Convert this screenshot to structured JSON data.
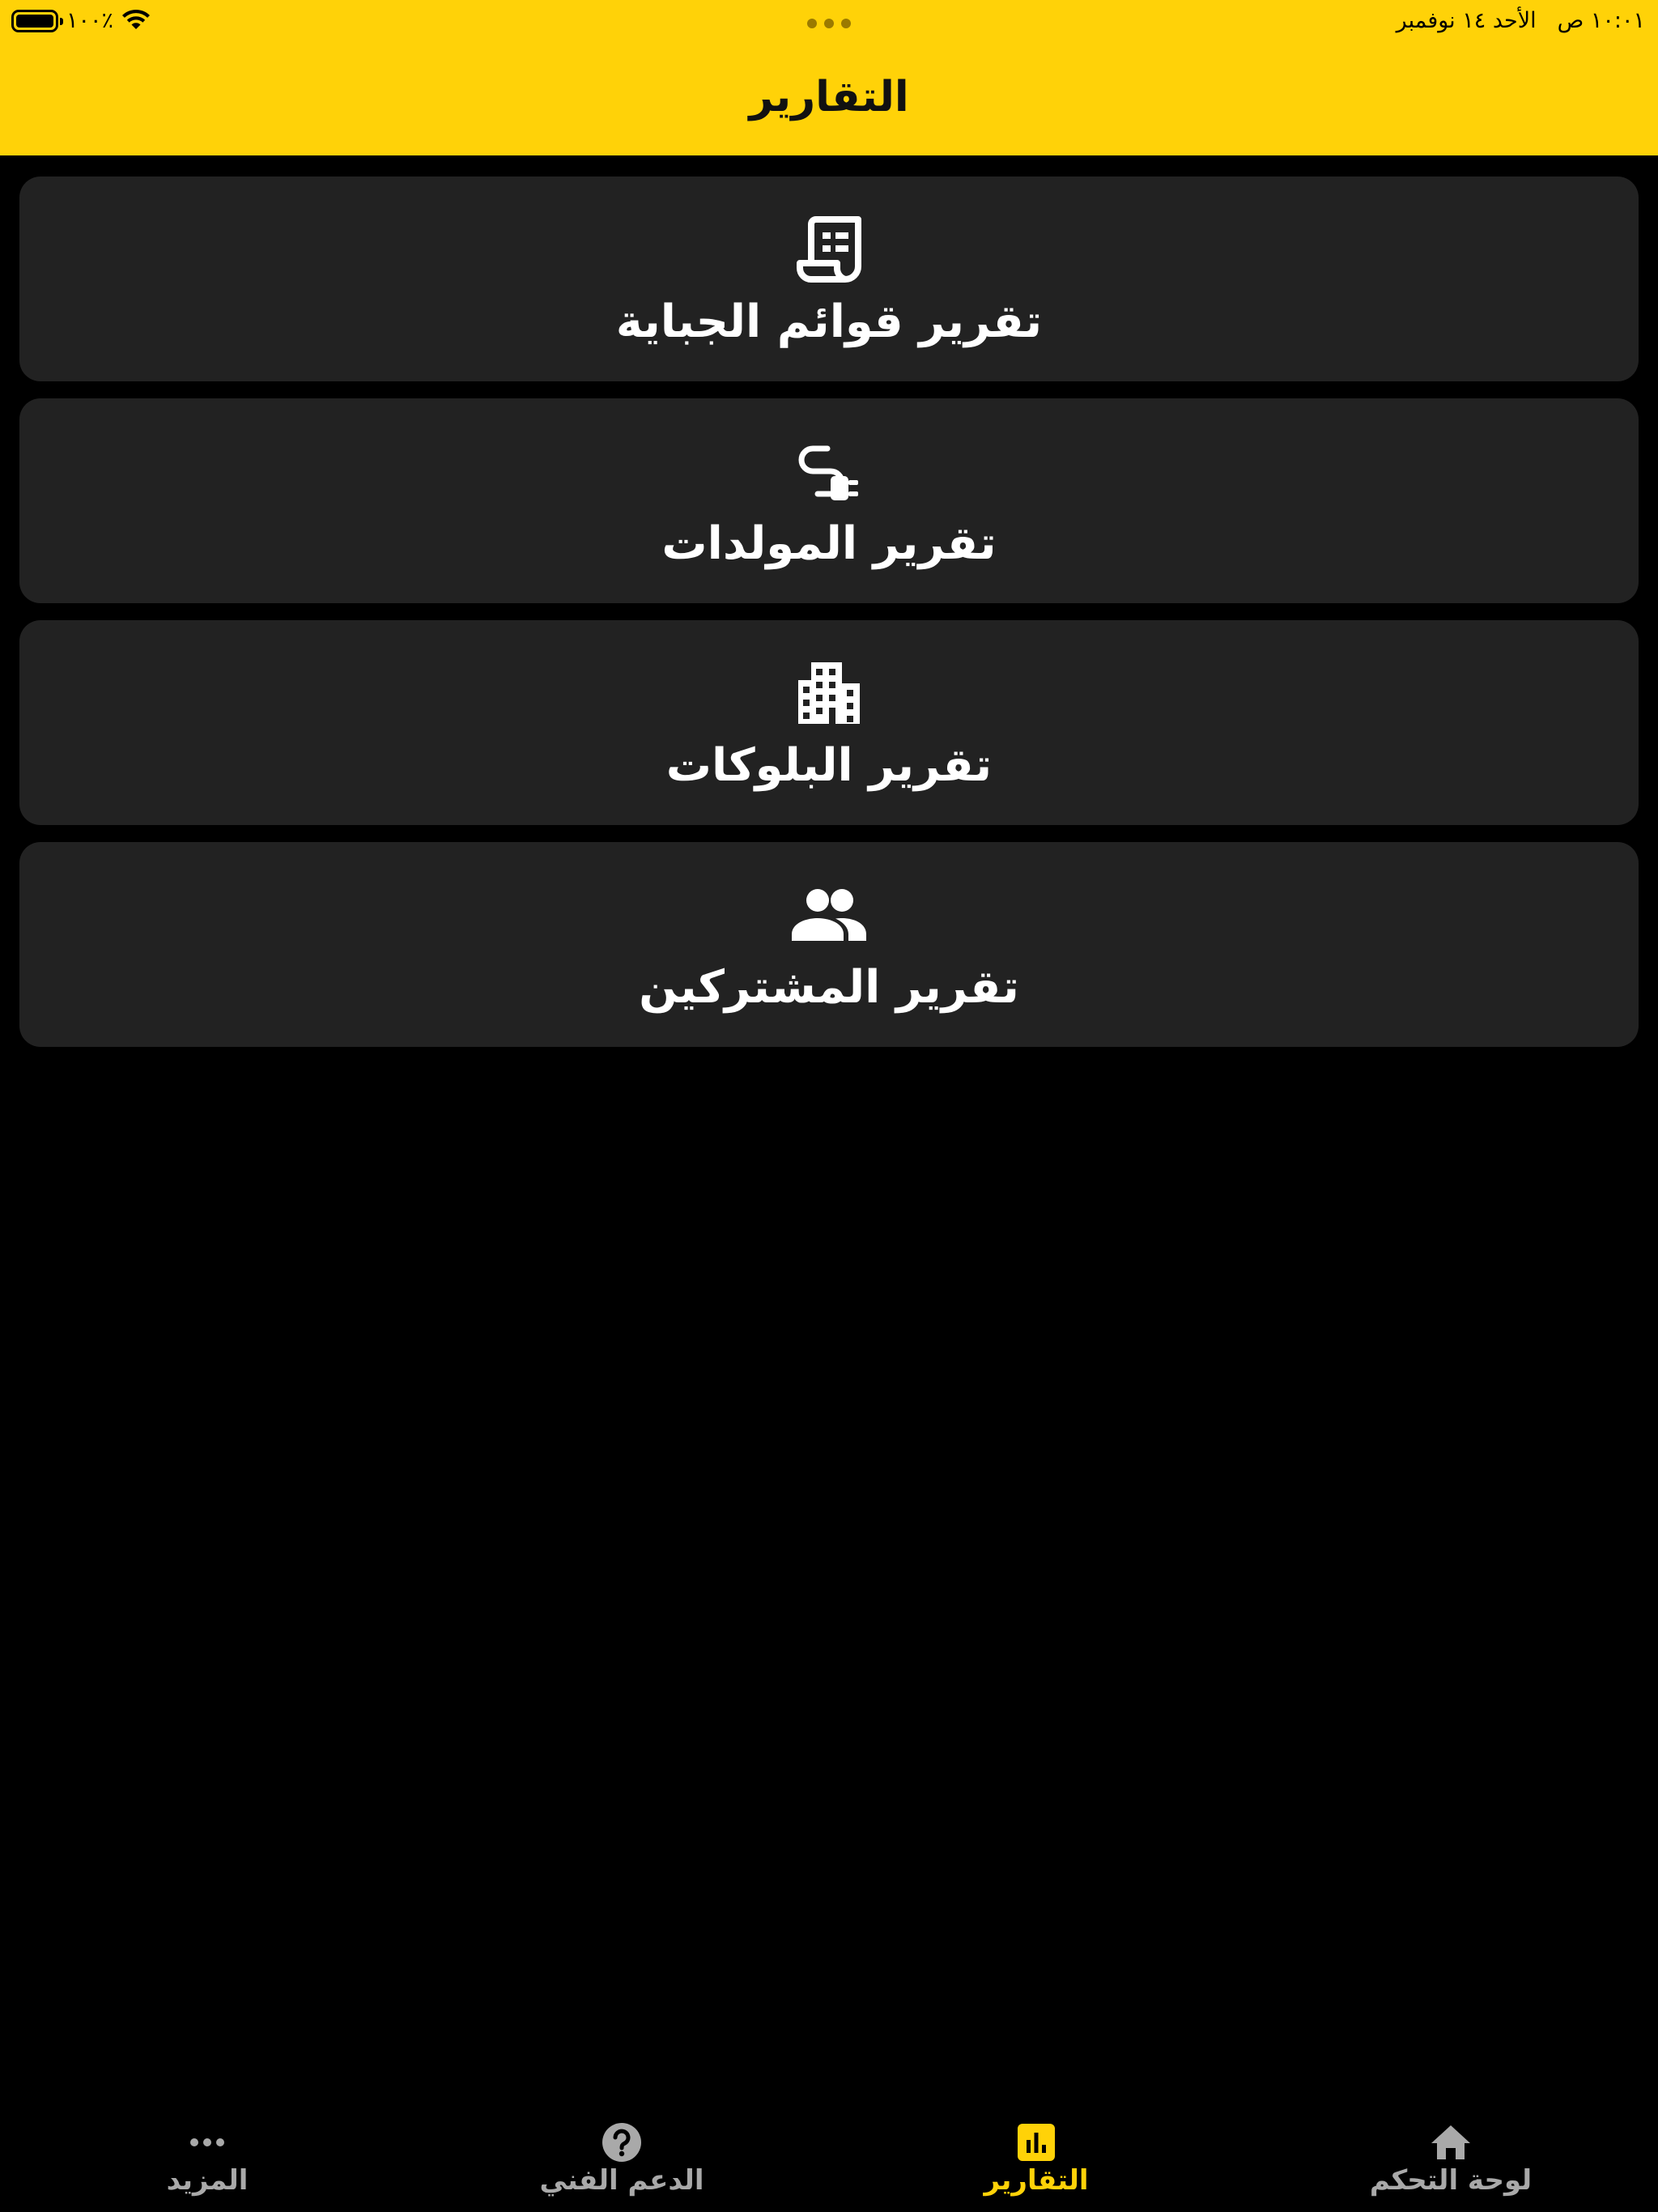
{
  "status_bar": {
    "time": "١٠:٠١ ص",
    "date": "الأحد ١٤ نوفمبر",
    "battery_text": "١٠٠٪",
    "battery_level": 1.0,
    "wifi_icon": "wifi-icon"
  },
  "header": {
    "title": "التقارير",
    "background_color": "#FFD208"
  },
  "reports": [
    {
      "label": "تقرير قوائم الجباية",
      "icon": "receipt-icon"
    },
    {
      "label": "تقرير المولدات",
      "icon": "power-plug-icon"
    },
    {
      "label": "تقرير البلوكات",
      "icon": "apartment-building-icon"
    },
    {
      "label": "تقرير المشتركين",
      "icon": "people-icon"
    }
  ],
  "tab_bar": {
    "tabs": [
      {
        "label": "لوحة التحكم",
        "icon": "home-icon",
        "active": false
      },
      {
        "label": "التقارير",
        "icon": "bar-chart-icon",
        "active": true
      },
      {
        "label": "الدعم الفني",
        "icon": "help-icon",
        "active": false
      },
      {
        "label": "المزيد",
        "icon": "more-dots-icon",
        "active": false
      }
    ],
    "active_color": "#FFD208",
    "inactive_color": "#A9A9A9"
  },
  "colors": {
    "background": "#000000",
    "card": "#222222",
    "card_text": "#FFFFFF"
  }
}
